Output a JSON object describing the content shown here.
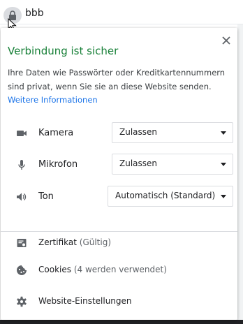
{
  "address_bar": {
    "url_text": "bbb"
  },
  "popup": {
    "title": "Verbindung ist sicher",
    "description_line1": "Ihre Daten wie Passwörter oder Kreditkartennummern",
    "description_line2": "sind privat, wenn Sie sie an diese Website senden.",
    "more_info": "Weitere Informationen",
    "permissions": [
      {
        "label": "Kamera",
        "value": "Zulassen",
        "icon": "camera-icon"
      },
      {
        "label": "Mikrofon",
        "value": "Zulassen",
        "icon": "microphone-icon"
      },
      {
        "label": "Ton",
        "value": "Automatisch (Standard)",
        "icon": "speaker-icon"
      }
    ],
    "certificate": {
      "label": "Zertifikat",
      "status": "(Gültig)"
    },
    "cookies": {
      "label": "Cookies",
      "status": "(4 werden verwendet)"
    },
    "site_settings": {
      "label": "Website-Einstellungen"
    }
  },
  "colors": {
    "secure_green": "#188038",
    "link_blue": "#1a73e8"
  }
}
